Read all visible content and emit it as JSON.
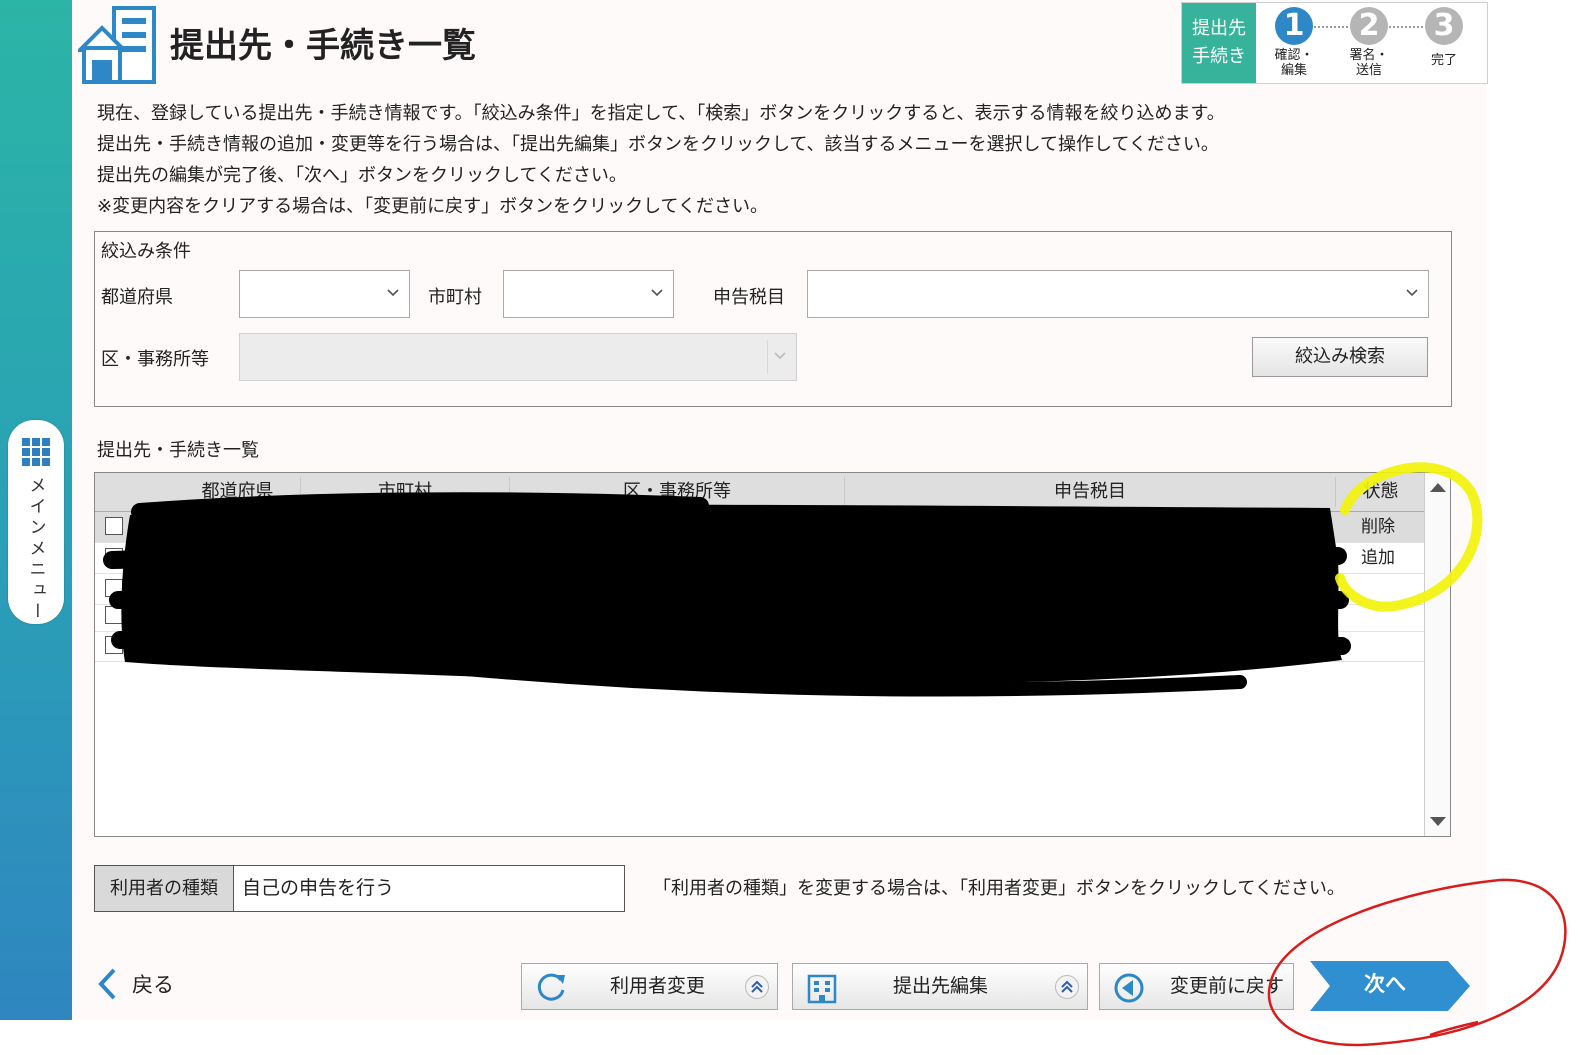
{
  "sidebar": {
    "menu_label": "メインメニュー"
  },
  "header": {
    "title": "提出先・手続き一覧"
  },
  "stepper": {
    "current_label_line1": "提出先",
    "current_label_line2": "手続き",
    "steps": [
      {
        "number": "1",
        "line1": "確認・",
        "line2": "編集",
        "color": "#2e88c8"
      },
      {
        "number": "2",
        "line1": "署名・",
        "line2": "送信",
        "color": "#b5b5b5"
      },
      {
        "number": "3",
        "line1": "完了",
        "line2": "",
        "color": "#b5b5b5"
      }
    ]
  },
  "description": {
    "line1": "現在、登録している提出先・手続き情報です。「絞込み条件」を指定して、「検索」ボタンをクリックすると、表示する情報を絞り込めます。",
    "line2": "提出先・手続き情報の追加・変更等を行う場合は、「提出先編集」ボタンをクリックして、該当するメニューを選択して操作してください。",
    "line3": "提出先の編集が完了後、「次へ」ボタンをクリックしてください。",
    "line4": "※変更内容をクリアする場合は、「変更前に戻す」ボタンをクリックしてください。"
  },
  "filter": {
    "title": "絞込み条件",
    "prefecture_label": "都道府県",
    "city_label": "市町村",
    "tax_label": "申告税目",
    "office_label": "区・事務所等",
    "search_button": "絞込み検索"
  },
  "list": {
    "title": "提出先・手続き一覧",
    "columns": [
      "都道府県",
      "市町村",
      "区・事務所等",
      "申告税目",
      "状態"
    ],
    "rows": [
      {
        "status": "削除"
      },
      {
        "status": "追加"
      },
      {
        "status": ""
      },
      {
        "status": ""
      },
      {
        "status": ""
      }
    ]
  },
  "user_type": {
    "label": "利用者の種類",
    "value": "自己の申告を行う",
    "note": "「利用者の種類」を変更する場合は、「利用者変更」ボタンをクリックしてください。"
  },
  "footer": {
    "back": "戻る",
    "change_user": "利用者変更",
    "edit_destination": "提出先編集",
    "revert": "変更前に戻す",
    "next": "次へ"
  },
  "colors": {
    "accent_teal": "#36b39a",
    "next_blue": "#2f8fd0",
    "highlight_yellow": "#f2f20a",
    "annotation_red": "#d81b1b"
  }
}
